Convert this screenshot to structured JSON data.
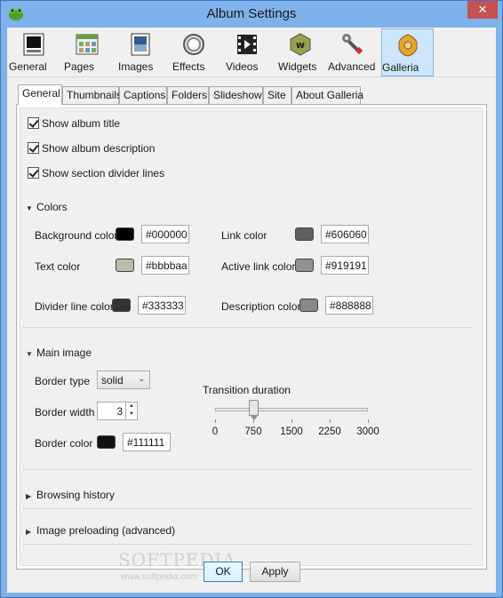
{
  "window": {
    "title": "Album Settings",
    "close_label": "✕"
  },
  "toolbar": {
    "buttons": [
      {
        "label": "General",
        "icon": "general-icon"
      },
      {
        "label": "Pages",
        "icon": "pages-icon"
      },
      {
        "label": "Images",
        "icon": "images-icon"
      },
      {
        "label": "Effects",
        "icon": "effects-icon"
      },
      {
        "label": "Videos",
        "icon": "videos-icon"
      },
      {
        "label": "Widgets",
        "icon": "widgets-icon"
      },
      {
        "label": "Advanced",
        "icon": "advanced-icon"
      },
      {
        "label": "Galleria",
        "icon": "galleria-icon",
        "active": true
      }
    ]
  },
  "tabs": [
    {
      "label": "General",
      "active": true
    },
    {
      "label": "Thumbnails"
    },
    {
      "label": "Captions"
    },
    {
      "label": "Folders"
    },
    {
      "label": "Slideshow"
    },
    {
      "label": "Site"
    },
    {
      "label": "About Galleria"
    }
  ],
  "checkboxes": [
    {
      "label": "Show album title",
      "checked": true
    },
    {
      "label": "Show album description",
      "checked": true
    },
    {
      "label": "Show section divider lines",
      "checked": true
    }
  ],
  "colors": {
    "heading": "Colors",
    "background": {
      "label": "Background color",
      "value": "#000000"
    },
    "text": {
      "label": "Text color",
      "value": "#bbbbaa"
    },
    "divider": {
      "label": "Divider line color",
      "value": "#333333"
    },
    "link": {
      "label": "Link color",
      "value": "#606060"
    },
    "active_link": {
      "label": "Active link color",
      "value": "#919191"
    },
    "description": {
      "label": "Description color",
      "value": "#888888"
    }
  },
  "main_image": {
    "heading": "Main image",
    "border_type_label": "Border type",
    "border_type_value": "solid",
    "border_width_label": "Border width",
    "border_width_value": "3",
    "border_color_label": "Border color",
    "border_color_value": "#111111",
    "transition_label": "Transition duration",
    "transition_value": 750,
    "transition_scale": [
      "0",
      "750",
      "1500",
      "2250",
      "3000"
    ],
    "transition_range": [
      0,
      3000
    ]
  },
  "collapsed_sections": {
    "browsing_history": "Browsing history",
    "image_preloading": "Image preloading (advanced)"
  },
  "footer": {
    "ok_label": "OK",
    "apply_label": "Apply"
  },
  "watermark": {
    "text": "SOFTPEDIA",
    "sub": "www.softpedia.com"
  }
}
